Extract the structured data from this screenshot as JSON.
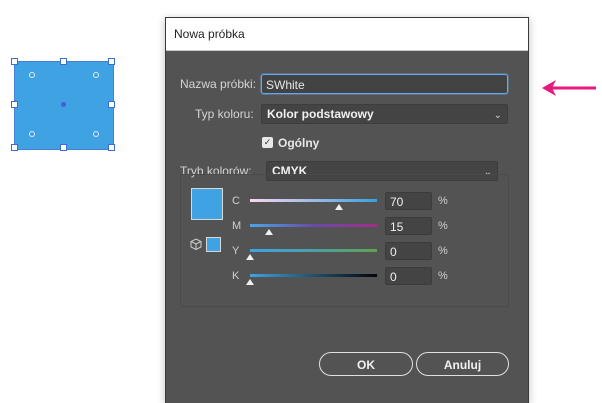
{
  "dialog": {
    "title": "Nowa próbka",
    "swatch_name_label": "Nazwa próbki:",
    "swatch_name_value": "SWhite",
    "color_type_label": "Typ koloru:",
    "color_type_value": "Kolor podstawowy",
    "global_checkbox_label": "Ogólny",
    "global_checked": true,
    "color_mode_label": "Tryb kolorów:",
    "color_mode_value": "CMYK",
    "swatch_color": "#3fa3e3",
    "channels": [
      {
        "label": "C",
        "value": "70",
        "unit": "%",
        "level_percent": 70
      },
      {
        "label": "M",
        "value": "15",
        "unit": "%",
        "level_percent": 15
      },
      {
        "label": "Y",
        "value": "0",
        "unit": "%",
        "level_percent": 0
      },
      {
        "label": "K",
        "value": "0",
        "unit": "%",
        "level_percent": 0
      }
    ],
    "ok_label": "OK",
    "cancel_label": "Anuluj"
  },
  "canvas": {
    "object_fill": "#3fa3e3",
    "pointer_color": "#e6197c"
  },
  "icons": {
    "dropdown": "chevron-down-icon",
    "checkbox": "checkmark-icon",
    "out_of_gamut": "cube-icon",
    "slider_thumb": "triangle-thumb-icon",
    "pointer": "arrow-left-icon"
  }
}
